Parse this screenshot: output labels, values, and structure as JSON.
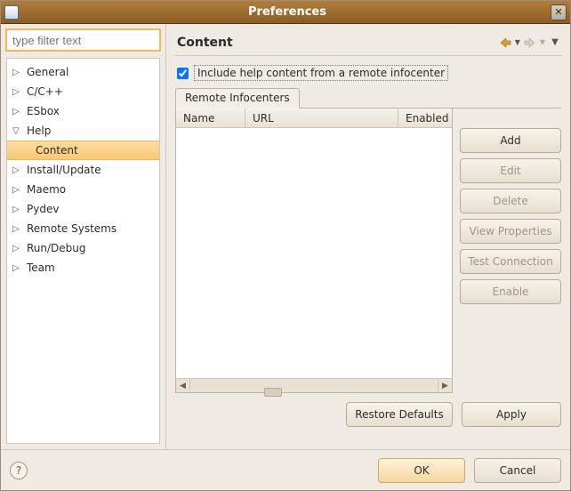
{
  "title": "Preferences",
  "filter_placeholder": "type filter text",
  "tree": {
    "items": [
      {
        "label": "General",
        "expandable": true
      },
      {
        "label": "C/C++",
        "expandable": true
      },
      {
        "label": "ESbox",
        "expandable": true
      },
      {
        "label": "Help",
        "expandable": true,
        "expanded": true,
        "children": [
          {
            "label": "Content",
            "selected": true
          }
        ]
      },
      {
        "label": "Install/Update",
        "expandable": true
      },
      {
        "label": "Maemo",
        "expandable": true
      },
      {
        "label": "Pydev",
        "expandable": true
      },
      {
        "label": "Remote Systems",
        "expandable": true
      },
      {
        "label": "Run/Debug",
        "expandable": true
      },
      {
        "label": "Team",
        "expandable": true
      }
    ]
  },
  "page": {
    "heading": "Content",
    "checkbox_label": "Include help content from a remote infocenter",
    "checkbox_checked": true,
    "tab_label": "Remote Infocenters",
    "columns": {
      "name": "Name",
      "url": "URL",
      "enabled": "Enabled"
    },
    "buttons": {
      "add": "Add",
      "edit": "Edit",
      "delete": "Delete",
      "view_props": "View Properties",
      "test_conn": "Test Connection",
      "enable": "Enable"
    },
    "restore_defaults": "Restore Defaults",
    "apply": "Apply"
  },
  "footer": {
    "ok": "OK",
    "cancel": "Cancel"
  }
}
